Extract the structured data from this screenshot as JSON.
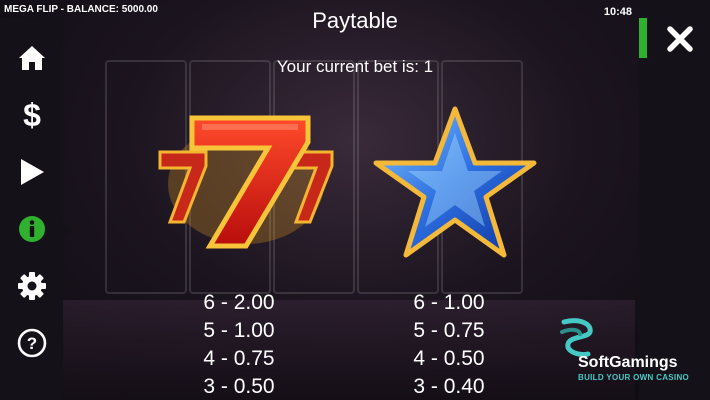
{
  "topbar": {
    "game_balance": "MEGA FLIP - BALANCE: 5000.00",
    "time": "10:48"
  },
  "paytable": {
    "title": "Paytable",
    "bet_line": "Your current bet is: 1",
    "symbols": [
      {
        "icon": "lucky-seven-icon",
        "payouts": [
          "6 - 2.00",
          "5 - 1.00",
          "4 - 0.75",
          "3 - 0.50"
        ]
      },
      {
        "icon": "blue-star-icon",
        "payouts": [
          "6 - 1.00",
          "5 - 0.75",
          "4 - 0.50",
          "3 - 0.40"
        ]
      }
    ]
  },
  "sidebar": {
    "items": [
      "home-icon",
      "dollar-icon",
      "play-icon",
      "info-icon",
      "gear-icon",
      "help-icon"
    ],
    "active": "info-icon"
  },
  "colors": {
    "active_green": "#2fb02f",
    "panel": "#141218",
    "brand_accent": "#46c9c4"
  },
  "branding": {
    "name": "SoftGamings",
    "tagline": "BUILD YOUR OWN CASINO"
  }
}
